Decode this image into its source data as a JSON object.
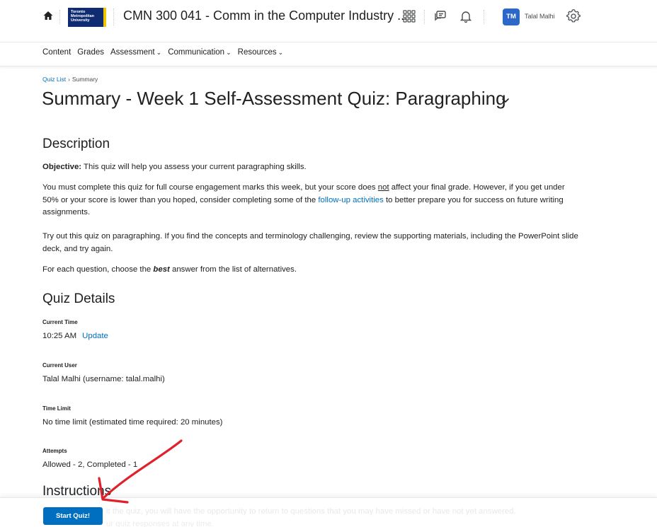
{
  "header": {
    "logo_text": "Toronto Metropolitan University",
    "course_title": "CMN 300 041 - Comm in the Computer Industry ...",
    "user_initials": "TM",
    "user_name": "Talal Malhi"
  },
  "nav": {
    "items": [
      {
        "label": "Content",
        "dropdown": false
      },
      {
        "label": "Grades",
        "dropdown": false
      },
      {
        "label": "Assessment",
        "dropdown": true
      },
      {
        "label": "Communication",
        "dropdown": true
      },
      {
        "label": "Resources",
        "dropdown": true
      }
    ]
  },
  "breadcrumb": {
    "link": "Quiz List",
    "separator": "›",
    "current": "Summary"
  },
  "page_title": "Summary - Week 1 Self-Assessment Quiz: Paragraphing",
  "description": {
    "heading": "Description",
    "objective_label": "Objective:",
    "objective_text": " This quiz will help you assess your current paragraphing skills.",
    "p2_part1": "You must complete this quiz for full course engagement marks this week, but your score does ",
    "p2_not": "not",
    "p2_part2": " affect your final grade. However, if you get under 50% or your score is lower than you hoped, consider completing some of the ",
    "p2_link": "follow-up activities",
    "p2_part3": " to better prepare you for success on future writing assignments.",
    "p3": "Try out this quiz on paragraphing.  If you find the concepts and terminology challenging, review the supporting materials, including the PowerPoint slide deck, and try again.",
    "p4_part1": "For each question, choose the ",
    "p4_best": "best",
    "p4_part2": " answer from the list of alternatives."
  },
  "quiz_details": {
    "heading": "Quiz Details",
    "current_time_label": "Current Time",
    "current_time_value": "10:25 AM",
    "update_link": "Update",
    "current_user_label": "Current User",
    "current_user_value": "Talal Malhi (username: talal.malhi)",
    "time_limit_label": "Time Limit",
    "time_limit_value": "No time limit (estimated time required: 20 minutes)",
    "attempts_label": "Attempts",
    "attempts_value": "Allowed - 2, Completed - 1"
  },
  "instructions": {
    "heading": "Instructions",
    "text_line1": "it the quiz, you will have the opportunity to return to questions that you may have missed or have not yet answered.",
    "text_line2": "ur quiz responses at any time."
  },
  "footer": {
    "start_button": "Start Quiz!"
  },
  "colors": {
    "link": "#006fbf",
    "button": "#006fbf",
    "annotation_arrow": "#e0202a",
    "avatar": "#2d68c9"
  },
  "icons": [
    "home-icon",
    "waffle-grid-icon",
    "message-alerts-icon",
    "bell-icon",
    "gear-icon",
    "chevron-down-icon",
    "annotation-arrow"
  ]
}
